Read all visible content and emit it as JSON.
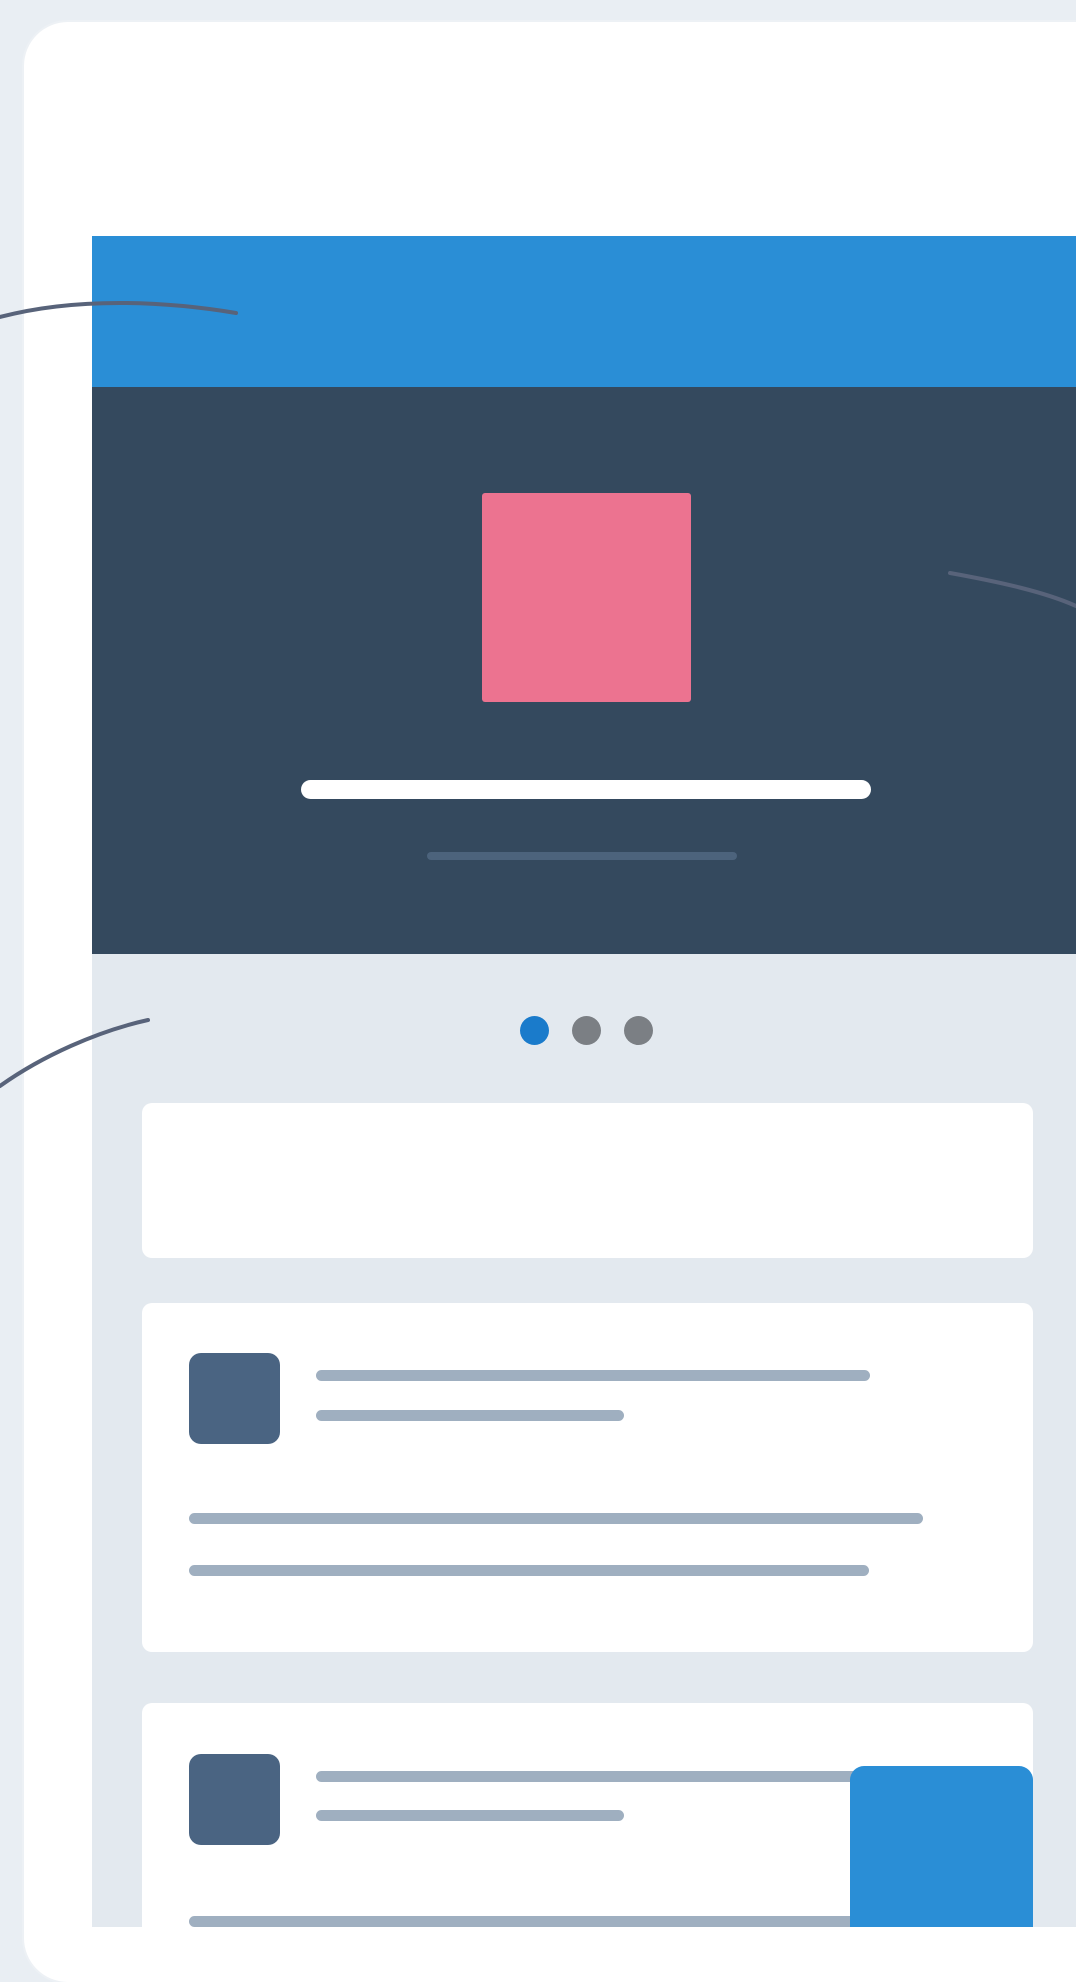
{
  "colors": {
    "page_background": "#e9eef3",
    "app_bar": "#2a8ed6",
    "hero_background": "#34495e",
    "hero_image": "#ec7390",
    "hero_title_bar": "#ffffff",
    "hero_subtitle_bar": "#4c637c",
    "screen_background": "#e3e9ef",
    "card_background": "#ffffff",
    "avatar": "#4a6482",
    "text_line": "#9fafc0",
    "dot_active": "#1a7bcb",
    "dot_inactive": "#7b7f84",
    "fab": "#2a8ed6",
    "connector_line": "#58637a"
  },
  "carousel": {
    "pages": 3,
    "active_page": 1
  },
  "cards": [
    {
      "kind": "empty"
    },
    {
      "kind": "list-item",
      "has_avatar": true,
      "title_lines": 2,
      "body_lines": 2
    },
    {
      "kind": "list-item",
      "has_avatar": true,
      "title_lines": 2,
      "body_lines": 1
    }
  ],
  "icons": {
    "hero_image": "image-placeholder",
    "fab": "floating-action-button"
  }
}
